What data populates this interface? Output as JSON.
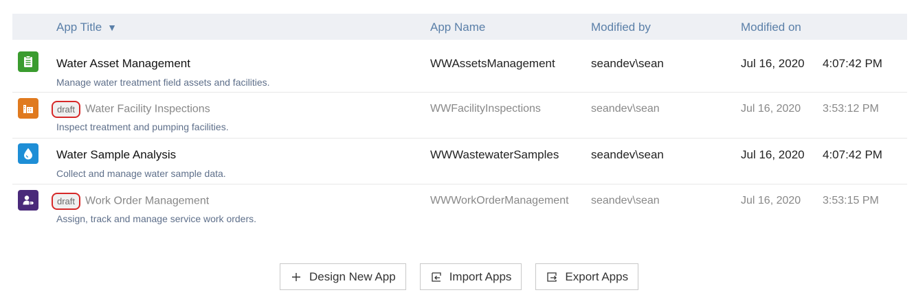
{
  "header": {
    "app_title": "App Title",
    "app_title_sort": "▼",
    "app_name": "App Name",
    "modified_by": "Modified by",
    "modified_on": "Modified on"
  },
  "rows": [
    {
      "title": "Water Asset Management",
      "description": "Manage water treatment field assets and facilities.",
      "app_name": "WWAssetsManagement",
      "modified_by": "seandev\\sean",
      "date": "Jul 16, 2020",
      "time": "4:07:42 PM",
      "icon": "clipboard-icon",
      "color": "#3a9c2f"
    },
    {
      "badge": "draft",
      "title": "Water Facility Inspections",
      "description": "Inspect treatment and pumping facilities.",
      "app_name": "WWFacilityInspections",
      "modified_by": "seandev\\sean",
      "date": "Jul 16, 2020",
      "time": "3:53:12 PM",
      "icon": "factory-icon",
      "color": "#e07a1f"
    },
    {
      "title": "Water Sample Analysis",
      "description": "Collect and manage water sample data.",
      "app_name": "WWWastewaterSamples",
      "modified_by": "seandev\\sean",
      "date": "Jul 16, 2020",
      "time": "4:07:42 PM",
      "icon": "water-drop-icon",
      "color": "#1e8ed6"
    },
    {
      "badge": "draft",
      "title": "Work Order Management",
      "description": "Assign, track and manage service work orders.",
      "app_name": "WWWorkOrderManagement",
      "modified_by": "seandev\\sean",
      "date": "Jul 16, 2020",
      "time": "3:53:15 PM",
      "icon": "user-tag-icon",
      "color": "#4a2a7a"
    }
  ],
  "buttons": {
    "design_new": "Design New App",
    "import": "Import Apps",
    "export": "Export Apps"
  }
}
